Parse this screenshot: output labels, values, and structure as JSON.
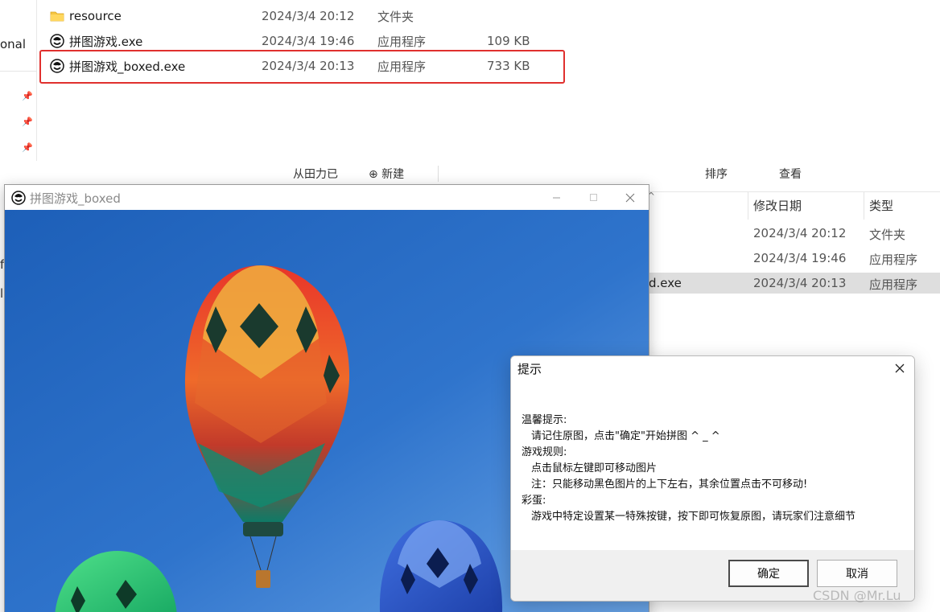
{
  "top_explorer": {
    "left_pane_text": "onal",
    "files": [
      {
        "icon": "folder-icon",
        "name": "resource",
        "date": "2024/3/4 20:12",
        "type": "文件夹",
        "size": ""
      },
      {
        "icon": "app-icon",
        "name": "拼图游戏.exe",
        "date": "2024/3/4 19:46",
        "type": "应用程序",
        "size": "109 KB"
      },
      {
        "icon": "app-icon",
        "name": "拼图游戏_boxed.exe",
        "date": "2024/3/4 20:13",
        "type": "应用程序",
        "size": "733 KB"
      }
    ],
    "highlight_color": "#e0302e",
    "toolbar_fragments": [
      "从田力已",
      "⊕ 新建",
      "排序",
      "查看"
    ]
  },
  "right_explorer": {
    "columns": [
      "修改日期",
      "类型"
    ],
    "rows": [
      {
        "name": "",
        "date": "2024/3/4 20:12",
        "type": "文件夹"
      },
      {
        "name": "",
        "date": "2024/3/4 19:46",
        "type": "应用程序"
      },
      {
        "name": "d.exe",
        "date": "2024/3/4 20:13",
        "type": "应用程序"
      }
    ],
    "sort_arrow": "^"
  },
  "left_edge_chars": [
    "f",
    "l"
  ],
  "game_window": {
    "title": "拼图游戏_boxed",
    "sky_color": "#2f74cc"
  },
  "dialog": {
    "title": "提示",
    "lines": [
      "温馨提示:",
      "请记住原图，点击\"确定\"开始拼图 ^ _ ^",
      "游戏规则:",
      "点击鼠标左键即可移动图片",
      "注：只能移动黑色图片的上下左右，其余位置点击不可移动!",
      "彩蛋:",
      "游戏中特定设置某一特殊按键，按下即可恢复原图，请玩家们注意细节"
    ],
    "ok_label": "确定",
    "cancel_label": "取消"
  },
  "watermark": "CSDN @Mr.Lu"
}
